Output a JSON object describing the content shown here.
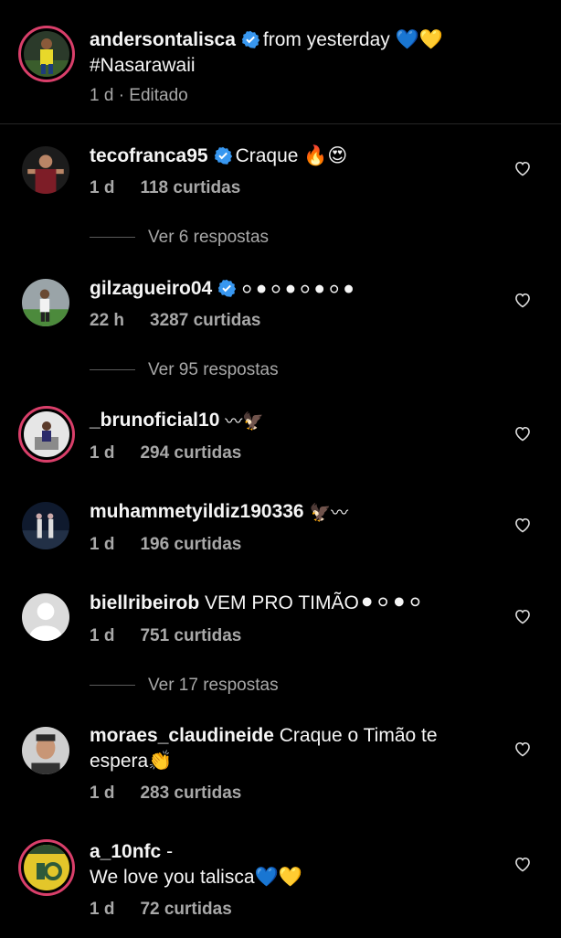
{
  "caption": {
    "username": "andersontalisca",
    "text": "from yesterday 💙💛",
    "hashtag": "#Nasarawaii",
    "meta": "1 d · Editado"
  },
  "comments": [
    {
      "username": "tecofranca95",
      "verified": true,
      "text": "Craque 🔥😍",
      "time": "1 d",
      "likes": "118 curtidas",
      "replies": "Ver 6 respostas"
    },
    {
      "username": "gilzagueiro04",
      "verified": true,
      "text": "⚪⚫⚪⚫⚪⚫⚪⚫",
      "time": "22 h",
      "likes": "3287 curtidas",
      "replies": "Ver 95 respostas"
    },
    {
      "username": "_brunoficial10",
      "verified": false,
      "text": "〰🦅",
      "time": "1 d",
      "likes": "294 curtidas",
      "replies": ""
    },
    {
      "username": "muhammetyildiz190336",
      "verified": false,
      "text": "🦅〰",
      "time": "1 d",
      "likes": "196 curtidas",
      "replies": ""
    },
    {
      "username": "biellribeirob",
      "verified": false,
      "text": "VEM PRO TIMÃO⚫⚪⚫⚪",
      "time": "1 d",
      "likes": "751 curtidas",
      "replies": "Ver 17 respostas"
    },
    {
      "username": "moraes_claudineide",
      "verified": false,
      "text": "Craque o Timão te",
      "text2": "espera👏",
      "time": "1 d",
      "likes": "283 curtidas",
      "replies": ""
    },
    {
      "username": "a_10nfc",
      "verified": false,
      "text": "-",
      "text2": "We love you talisca💙💛",
      "time": "1 d",
      "likes": "72 curtidas",
      "replies": ""
    }
  ],
  "colors": {
    "background": "#000000",
    "text": "#f5f5f5",
    "secondary": "#a8a8a8",
    "verified": "#3897f0",
    "story_ring": "#d93f6a"
  },
  "icons": {
    "like": "heart-outline-icon",
    "verified": "verified-badge-icon"
  }
}
